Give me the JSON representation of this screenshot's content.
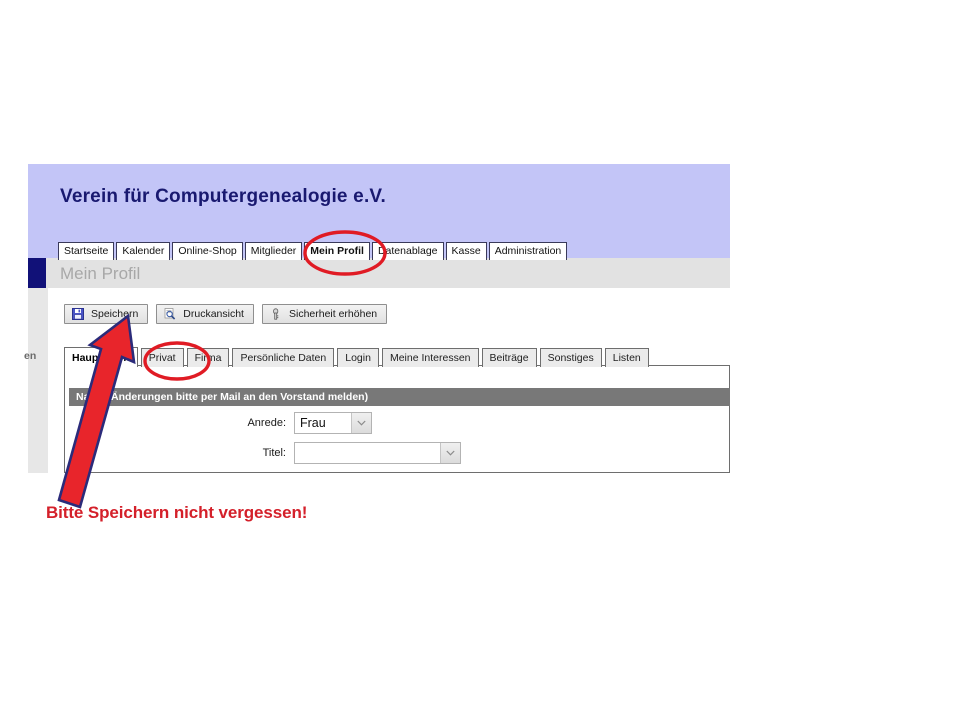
{
  "brand": {
    "title": "Verein für Computergenealogie e.V."
  },
  "nav": {
    "tabs": [
      {
        "label": "Startseite",
        "active": false
      },
      {
        "label": "Kalender",
        "active": false
      },
      {
        "label": "Online-Shop",
        "active": false
      },
      {
        "label": "Mitglieder",
        "active": false
      },
      {
        "label": "Mein Profil",
        "active": true
      },
      {
        "label": "Datenablage",
        "active": false
      },
      {
        "label": "Kasse",
        "active": false
      },
      {
        "label": "Administration",
        "active": false
      }
    ]
  },
  "page": {
    "title": "Mein Profil",
    "left_rail_label": "en"
  },
  "toolbar": {
    "buttons": [
      {
        "label": "Speichern",
        "icon": "floppy-disk-icon"
      },
      {
        "label": "Druckansicht",
        "icon": "print-preview-icon"
      },
      {
        "label": "Sicherheit erhöhen",
        "icon": "key-icon"
      }
    ]
  },
  "subtabs": {
    "tabs": [
      {
        "label": "Hauptdaten",
        "active": true
      },
      {
        "label": "Privat",
        "active": false
      },
      {
        "label": "Firma",
        "active": false
      },
      {
        "label": "Persönliche Daten",
        "active": false
      },
      {
        "label": "Login",
        "active": false
      },
      {
        "label": "Meine Interessen",
        "active": false
      },
      {
        "label": "Beiträge",
        "active": false
      },
      {
        "label": "Sonstiges",
        "active": false
      },
      {
        "label": "Listen",
        "active": false
      }
    ]
  },
  "form": {
    "section_title": "Name (Änderungen bitte per Mail an den Vorstand melden)",
    "fields": [
      {
        "label": "Anrede:",
        "value": "Frau"
      },
      {
        "label": "Titel:",
        "value": ""
      }
    ]
  },
  "annotations": {
    "caption": "Bitte Speichern nicht vergessen!",
    "highlight_color": "#E01B24",
    "arrow_fill": "#E8252B",
    "arrow_outline": "#2B2B7A",
    "circles": [
      {
        "target": "Mein Profil"
      },
      {
        "target": "Privat"
      }
    ],
    "arrow_target": "Speichern"
  },
  "colors": {
    "brand_header": "#C3C5F7",
    "brand_text": "#191970",
    "title_bar": "#E2E2E2",
    "title_text": "#A8A8A8",
    "section_header": "#787878",
    "accent_navy": "#111178"
  }
}
